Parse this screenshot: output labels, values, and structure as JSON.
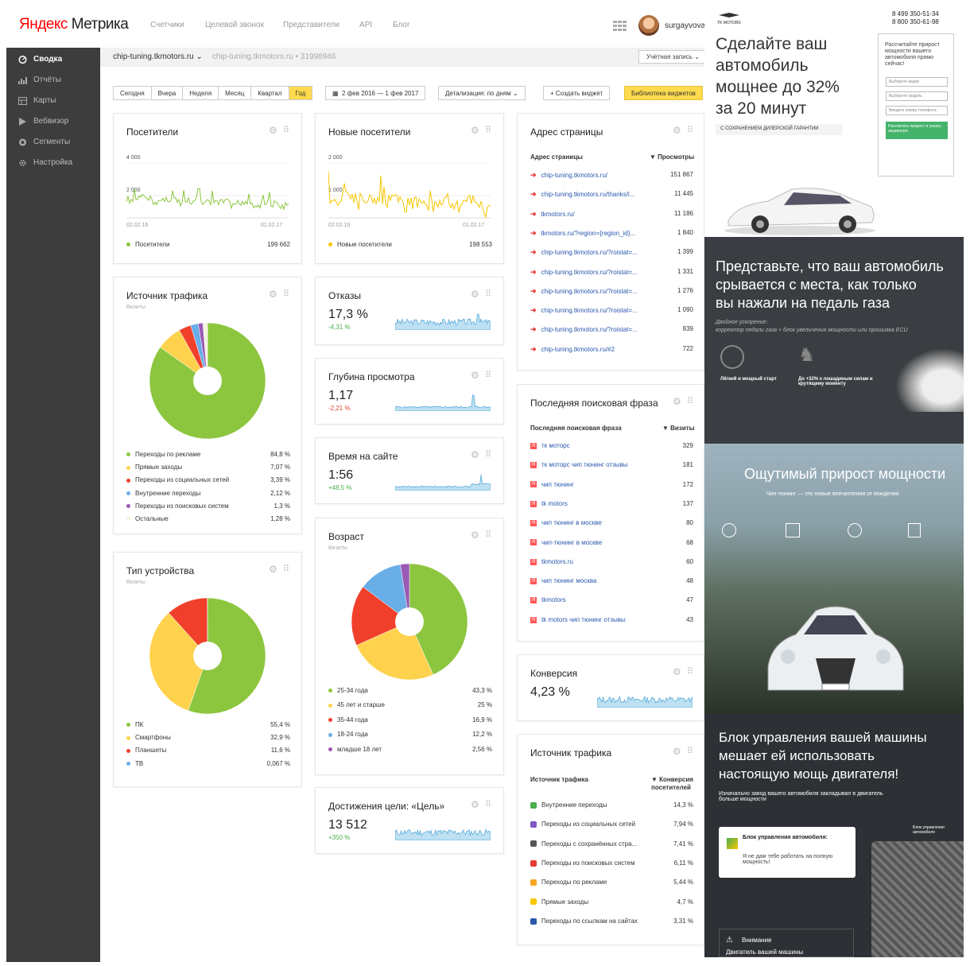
{
  "header": {
    "logo_brand": "Яндекс",
    "logo_product": "Метрика",
    "nav": [
      "Счетчики",
      "Целевой звонок",
      "Представители",
      "API",
      "Блог"
    ],
    "username": "surgayvova"
  },
  "sidebar": {
    "items": [
      {
        "label": "Сводка",
        "icon": "dashboard-icon",
        "active": true
      },
      {
        "label": "Отчёты",
        "icon": "bar-chart-icon"
      },
      {
        "label": "Карты",
        "icon": "map-icon"
      },
      {
        "label": "Вебвизор",
        "icon": "play-icon"
      },
      {
        "label": "Сегменты",
        "icon": "segments-icon"
      },
      {
        "label": "Настройка",
        "icon": "gear-icon"
      }
    ]
  },
  "subheader": {
    "site": "chip-tuning.tkmotors.ru",
    "site_id": "chip-tuning.tkmotors.ru • 31998946",
    "account": "Учётная запись"
  },
  "toolbar": {
    "periods": [
      "Сегодня",
      "Вчера",
      "Неделя",
      "Месяц",
      "Квартал",
      "Год"
    ],
    "selected_period": "Год",
    "date_range": "2 фев 2016 — 1 фев 2017",
    "detail": "Детализация: по дням",
    "create_widget": "Создать виджет",
    "library": "Библиотека виджетов"
  },
  "widgets": {
    "visitors": {
      "title": "Посетители",
      "y_ticks": [
        "4 000",
        "2 000"
      ],
      "x_ticks": [
        "02.02.16",
        "01.02.17"
      ],
      "legend": "Посетители",
      "total": "199 662",
      "color": "#8cc63f"
    },
    "new_visitors": {
      "title": "Новые посетители",
      "y_ticks": [
        "2 000",
        "1 000"
      ],
      "x_ticks": [
        "02.02.16",
        "01.02.17"
      ],
      "legend": "Новые посетители",
      "total": "198 553",
      "color": "#f7c600"
    },
    "bounces": {
      "title": "Отказы",
      "value": "17,3 %",
      "delta": "-4,31 %"
    },
    "depth": {
      "title": "Глубина просмотра",
      "value": "1,17",
      "delta": "-2,21 %"
    },
    "time": {
      "title": "Время на сайте",
      "value": "1:56",
      "delta": "+48,5 %"
    },
    "conversion": {
      "title": "Конверсия",
      "value": "4,23 %"
    },
    "goal": {
      "title": "Достижения цели: «Цель»",
      "value": "13 512",
      "delta": "+350 %"
    },
    "traffic": {
      "title": "Источник трафика",
      "subtitle": "Визиты"
    },
    "device": {
      "title": "Тип устройства",
      "subtitle": "Визиты"
    },
    "age": {
      "title": "Возраст",
      "subtitle": "Визиты"
    },
    "pages": {
      "title": "Адрес страницы",
      "col1": "Адрес страницы",
      "col2": "▼ Просмотры",
      "rows": [
        {
          "url": "chip-tuning.tkmotors.ru/",
          "views": "151 867"
        },
        {
          "url": "chip-tuning.tkmotors.ru/thanks/i...",
          "views": "11 445"
        },
        {
          "url": "tkmotors.ru/",
          "views": "11 186"
        },
        {
          "url": "tkmotors.ru/?region={region_id}...",
          "views": "1 840"
        },
        {
          "url": "chip-tuning.tkmotors.ru/?roistat=...",
          "views": "1 399"
        },
        {
          "url": "chip-tuning.tkmotors.ru/?roistat=...",
          "views": "1 331"
        },
        {
          "url": "chip-tuning.tkmotors.ru/?roistat=...",
          "views": "1 276"
        },
        {
          "url": "chip-tuning.tkmotors.ru/?roistat=...",
          "views": "1 090"
        },
        {
          "url": "chip-tuning.tkmotors.ru/?roistat=...",
          "views": "839"
        },
        {
          "url": "chip-tuning.tkmotors.ru/#2",
          "views": "722"
        }
      ]
    },
    "search": {
      "title": "Последняя поисковая фраза",
      "col1": "Последняя поисковая фраза",
      "col2": "▼ Визиты",
      "rows": [
        {
          "q": "тк моторс",
          "v": "329"
        },
        {
          "q": "тк моторс чип тюнинг отзывы",
          "v": "181"
        },
        {
          "q": "чип тюнинг",
          "v": "172"
        },
        {
          "q": "tk motors",
          "v": "137"
        },
        {
          "q": "чип тюнинг в москве",
          "v": "80"
        },
        {
          "q": "чип-тюнинг в москве",
          "v": "68"
        },
        {
          "q": "tkmotors.ru",
          "v": "60"
        },
        {
          "q": "чип тюнинг москва",
          "v": "48"
        },
        {
          "q": "tkmotors",
          "v": "47"
        },
        {
          "q": "tk motors чип тюнинг отзывы",
          "v": "43"
        }
      ]
    },
    "traffic_conv": {
      "title": "Источник трафика",
      "col1": "Источник трафика",
      "col2a": "▼ Конверсия",
      "col2b": "посетителей",
      "rows": [
        {
          "label": "Внутренние переходы",
          "v": "14,3 %",
          "icon": "#4cae4c"
        },
        {
          "label": "Переходы из социальных сетей",
          "v": "7,94 %",
          "icon": "#7e57c2"
        },
        {
          "label": "Переходы с сохранённых стра...",
          "v": "7,41 %",
          "icon": "#555555"
        },
        {
          "label": "Переходы из поисковых систем",
          "v": "6,11 %",
          "icon": "#e53935"
        },
        {
          "label": "Переходы по рекламе",
          "v": "5,44 %",
          "icon": "#f5a623"
        },
        {
          "label": "Прямые заходы",
          "v": "4,7 %",
          "icon": "#f7c600"
        },
        {
          "label": "Переходы по ссылкам на сайтах",
          "v": "3,31 %",
          "icon": "#2a58ad"
        }
      ]
    }
  },
  "chart_data": [
    {
      "type": "pie",
      "title": "Источник трафика",
      "subtitle": "Визиты",
      "categories": [
        "Переходы по рекламе",
        "Прямые заходы",
        "Переходы из социальных сетей",
        "Внутренние переходы",
        "Переходы из поисковых систем",
        "Остальные"
      ],
      "values": [
        84.8,
        7.07,
        3.39,
        2.12,
        1.3,
        1.28
      ],
      "labels": [
        "84,8 %",
        "7,07 %",
        "3,39 %",
        "2,12 %",
        "1,3 %",
        "1,28 %"
      ],
      "colors": [
        "#8cc63f",
        "#ffd24d",
        "#f0402b",
        "#6aaee8",
        "#9b59b6",
        "#f3f3e0"
      ]
    },
    {
      "type": "pie",
      "title": "Тип устройства",
      "subtitle": "Визиты",
      "categories": [
        "ПК",
        "Смартфоны",
        "Планшеты",
        "ТВ"
      ],
      "values": [
        55.4,
        32.9,
        11.6,
        0.067
      ],
      "labels": [
        "55,4 %",
        "32,9 %",
        "11,6 %",
        "0,067 %"
      ],
      "colors": [
        "#8cc63f",
        "#ffd24d",
        "#f0402b",
        "#6aaee8"
      ]
    },
    {
      "type": "pie",
      "title": "Возраст",
      "subtitle": "Визиты",
      "categories": [
        "25-34 года",
        "45 лет и старше",
        "35-44 года",
        "18-24 года",
        "младше 18 лет"
      ],
      "values": [
        43.3,
        25,
        16.9,
        12.2,
        2.56
      ],
      "labels": [
        "43,3 %",
        "25 %",
        "16,9 %",
        "12,2 %",
        "2,56 %"
      ],
      "colors": [
        "#8cc63f",
        "#ffd24d",
        "#f0402b",
        "#6aaee8",
        "#9b59b6"
      ]
    }
  ],
  "ad": {
    "phone1": "8 499 350-51-34",
    "phone2": "8 800 350-61-98",
    "brand": "TK MOTORS",
    "headline": [
      "Сделайте ваш",
      "автомобиль",
      "мощнее до 32%",
      "за 20 минут"
    ],
    "badge": "С СОХРАНЕНИЕМ ДИЛЕРСКОЙ ГАРАНТИИ",
    "form_title": "Рассчитайте прирост мощности вашего автомобиля прямо сейчас!",
    "form_fields": [
      "Выберите марку",
      "Выберите модель",
      "Введите номер телефона"
    ],
    "form_button": "Рассчитать прирост и узнать акционную",
    "s2_title": [
      "Представьте, что ваш автомобиль",
      "срывается с места, как только",
      "вы нажали на педаль газа"
    ],
    "s2_sub": "Двойное ускорение:",
    "s2_sub2": "корректор педали газа + блок увеличения мощности или прошивка ECU",
    "s2_f1": "Лёгкий и мощный старт",
    "s2_f2": "До +32% к лошадиным силам и крутящему моменту",
    "s3_title": "Ощутимый прирост мощности",
    "s3_sub": "Чип-тюнинг — это новые впечатления от вождения",
    "s4_title": [
      "Блок управления вашей машины",
      "мешает ей использовать",
      "настоящую мощь двигателя!"
    ],
    "s4_sub": "Изначально завод вашего автомобиля закладывал в двигатель больше мощности",
    "s4_card_title": "Блок управления автомобиля:",
    "s4_card_text": "Я не дам тебе работать на полную мощность!",
    "s4_tag": "Блок управления автомобиля",
    "s4_warn": "Внимание",
    "s4_warn2": "Двигатель вашей машины"
  }
}
